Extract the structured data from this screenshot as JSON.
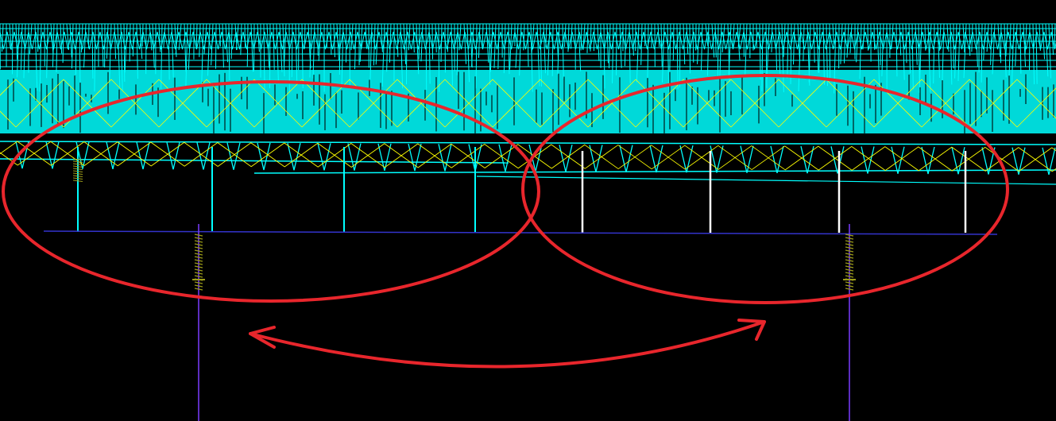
{
  "view": {
    "description_text": "",
    "colors": {
      "background": "#000000",
      "truss": "#00ffff",
      "bracing": "#ffff00",
      "highlight_post": "#ffffff",
      "ground_line": "#3333cc",
      "pile": "#7a3cff",
      "spring": "#9b9b1a",
      "annotation": "#e8262c"
    },
    "icons": {
      "callout_left": "red-ellipse",
      "callout_right": "red-ellipse",
      "comparison_arrow": "double-headed-curved-arrow"
    },
    "elements": {
      "cyan_columns_count": 4,
      "white_columns_count": 4,
      "piles_count": 2
    }
  }
}
